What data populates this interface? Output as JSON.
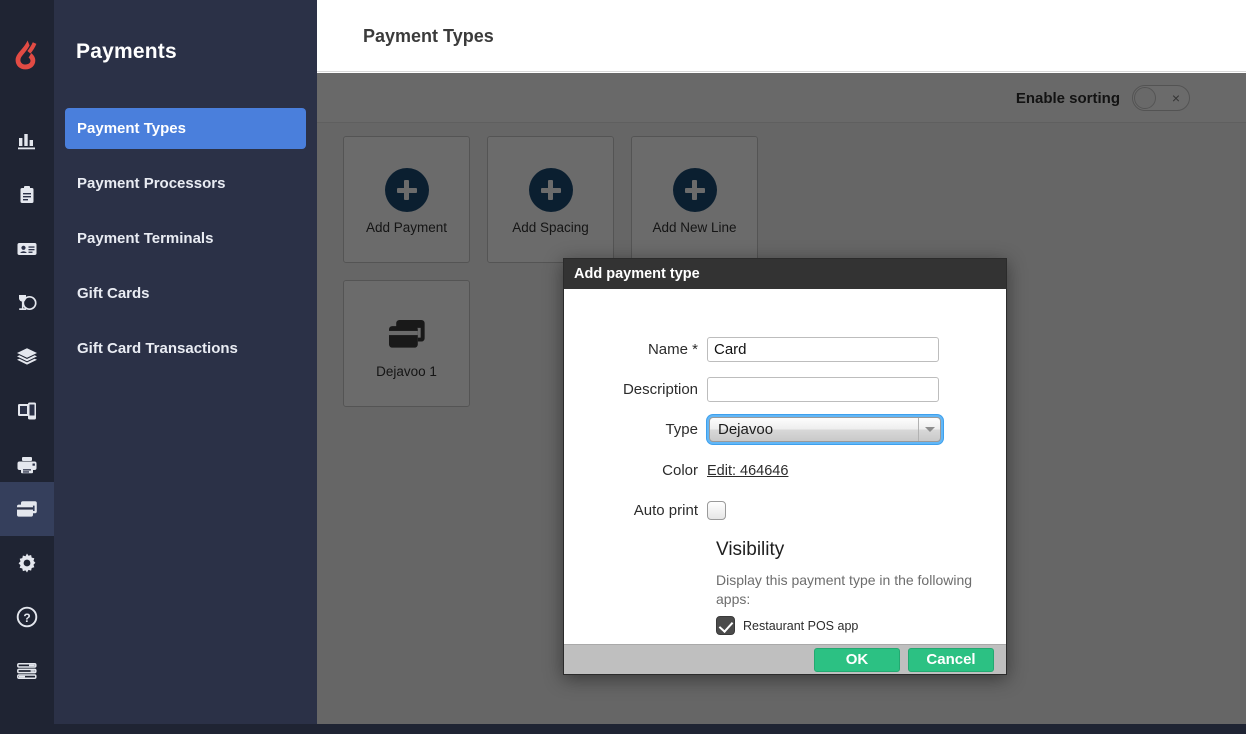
{
  "app": {
    "logo_icon": "lightspeed-flame-logo",
    "rail_icons": [
      "bar-chart-icon",
      "clipboard-icon",
      "id-card-icon",
      "wine-glass-icon",
      "layers-icon",
      "devices-icon",
      "printer-icon",
      "payment-cards-icon",
      "gear-icon",
      "help-circle-icon",
      "sliders-icon"
    ],
    "rail_active_index": 7
  },
  "sidebar": {
    "title": "Payments",
    "items": [
      {
        "label": "Payment Types",
        "active": true
      },
      {
        "label": "Payment Processors",
        "active": false
      },
      {
        "label": "Payment Terminals",
        "active": false
      },
      {
        "label": "Gift Cards",
        "active": false
      },
      {
        "label": "Gift Card Transactions",
        "active": false
      }
    ]
  },
  "header": {
    "title": "Payment Types"
  },
  "toolbar": {
    "sorting_label": "Enable sorting",
    "sorting_enabled": false,
    "toggle_off_mark": "×"
  },
  "tiles": {
    "rows": [
      [
        {
          "label": "Add Payment",
          "icon": "plus-circle-icon"
        },
        {
          "label": "Add Spacing",
          "icon": "plus-circle-icon"
        },
        {
          "label": "Add New Line",
          "icon": "plus-circle-icon"
        }
      ],
      [
        {
          "label": "Dejavoo 1",
          "icon": "payment-cards-icon"
        }
      ]
    ]
  },
  "dialog": {
    "title": "Add payment type",
    "fields": {
      "name_label": "Name *",
      "name_value": "Card",
      "name_placeholder": "",
      "description_label": "Description",
      "description_value": "",
      "description_placeholder": "",
      "type_label": "Type",
      "type_value": "Dejavoo",
      "type_options": [
        "Dejavoo"
      ],
      "color_label": "Color",
      "color_link": "Edit: 464646",
      "color_hex": "#464646",
      "autoprint_label": "Auto print",
      "autoprint_checked": false
    },
    "visibility": {
      "heading": "Visibility",
      "description": "Display this payment type in the following apps:",
      "apps": [
        {
          "label": "Restaurant POS app",
          "checked": true
        }
      ]
    },
    "buttons": {
      "ok": "OK",
      "cancel": "Cancel"
    }
  },
  "colors": {
    "accent_blue": "#4a7fdc",
    "rail_bg": "#1f2433",
    "nav_bg": "#2b3147",
    "logo_red": "#e24b44",
    "plus_circle": "#1b4a74",
    "button_green": "#2cc183",
    "focus_ring": "#62b7f7"
  }
}
